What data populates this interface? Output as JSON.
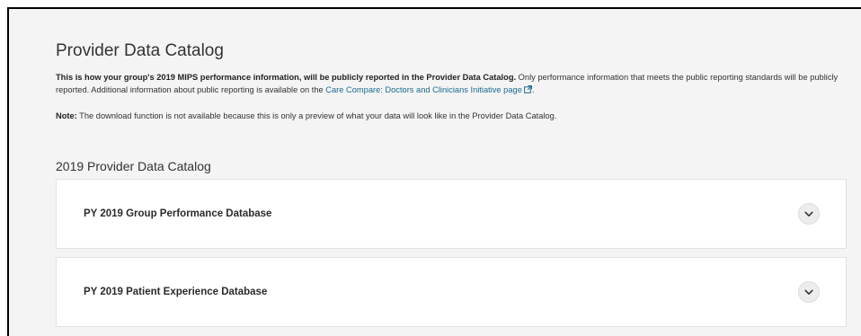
{
  "page": {
    "title": "Provider Data Catalog",
    "intro_bold": "This is how your group's 2019 MIPS performance information, will be publicly reported in the Provider Data Catalog.",
    "intro_text": " Only performance information that meets the public reporting standards will be publicly reported. Additional information about public reporting is available on the ",
    "intro_link": "Care Compare: Doctors and Clinicians Initiative page",
    "intro_end": ".",
    "note_label": "Note:",
    "note_text": " The download function is not available because this is only a preview of what your data will look like in the Provider Data Catalog.",
    "section_heading": "2019 Provider Data Catalog"
  },
  "accordions": [
    {
      "title": "PY 2019 Group Performance Database",
      "icon": "chevron-down-icon"
    },
    {
      "title": "PY 2019 Patient Experience Database",
      "icon": "chevron-down-icon"
    }
  ],
  "colors": {
    "link": "#1b6b8f",
    "background": "#f4f4f4",
    "card": "#ffffff"
  }
}
